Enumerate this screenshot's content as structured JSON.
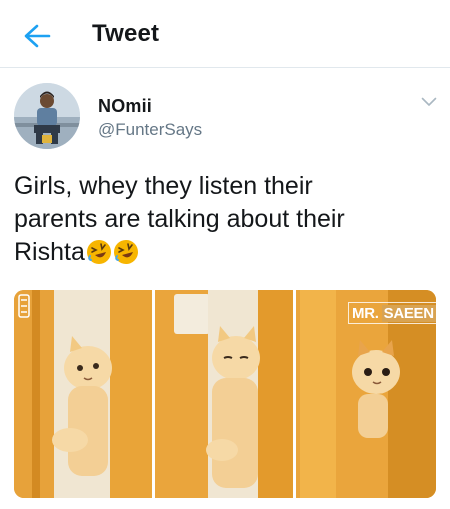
{
  "header": {
    "title": "Tweet",
    "back_icon": "arrow-left-icon",
    "accent_color": "#1da1f2"
  },
  "tweet": {
    "author": {
      "display_name": "NOmii",
      "username": "@FunterSays",
      "avatar_icon": "avatar"
    },
    "more_icon": "chevron-down-icon",
    "text_lines": [
      "Girls, whey they listen their",
      "parents are talking about their",
      "Rishta"
    ],
    "emoji_icon": "rolling-laughing-emoji-icon",
    "media": {
      "watermark_part1": "MR.",
      "watermark_part2": "SAEEN",
      "panel_count": 3
    }
  },
  "colors": {
    "text_primary": "#14171a",
    "text_secondary": "#657786",
    "divider": "#e1e8ed"
  }
}
